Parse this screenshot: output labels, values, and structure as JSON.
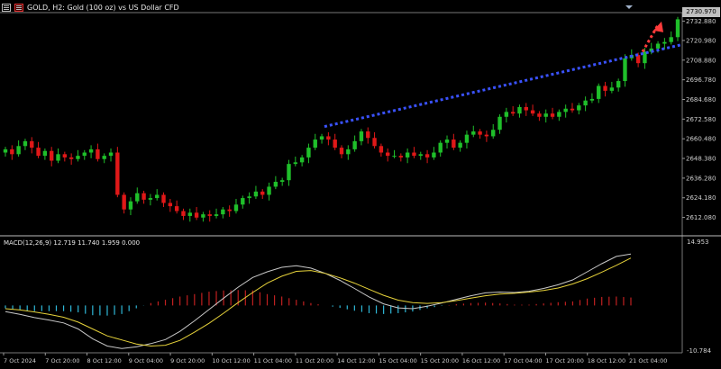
{
  "window": {
    "title": "GOLD, H2:  Gold (100 oz) vs US Dollar CFD",
    "current_price_label": "2730.970"
  },
  "macd": {
    "label": "MACD(12,26,9) 12.719 11.740 1.959 0.000",
    "top_label": "14.953",
    "bottom_label": "-10.784"
  },
  "colors": {
    "background": "#000000",
    "bull_candle": "#1fbf2a",
    "bear_candle": "#e01818",
    "trendline": "#3a52ff",
    "projection_arrow": "#ff3b3b",
    "hist_positive": "#c02020",
    "hist_negative": "#2fb8d8",
    "macd_line": "#c8c8c8",
    "signal_line": "#e6d23a",
    "axis": "#a0a0a0"
  },
  "chart_data": [
    {
      "type": "candlestick",
      "series_name": "GOLD H2",
      "y_ticks": [
        "2732.880",
        "2720.980",
        "2708.880",
        "2696.780",
        "2684.680",
        "2672.580",
        "2660.480",
        "2648.380",
        "2636.280",
        "2624.180",
        "2612.080"
      ],
      "x_ticks": [
        "7 Oct 2024",
        "7 Oct 20:00",
        "8 Oct 12:00",
        "9 Oct 04:00",
        "9 Oct 20:00",
        "10 Oct 12:00",
        "11 Oct 04:00",
        "11 Oct 20:00",
        "14 Oct 12:00",
        "15 Oct 04:00",
        "15 Oct 20:00",
        "16 Oct 12:00",
        "17 Oct 04:00",
        "17 Oct 20:00",
        "18 Oct 12:00",
        "21 Oct 04:00"
      ],
      "ylim": [
        2603.0,
        2737.0
      ],
      "closes": [
        2654,
        2651,
        2656,
        2659,
        2655,
        2650,
        2653,
        2647,
        2651,
        2649,
        2648,
        2650,
        2652,
        2654,
        2648,
        2650,
        2652,
        2626,
        2617,
        2622,
        2627,
        2623,
        2624,
        2626,
        2621,
        2619,
        2616,
        2613,
        2615,
        2612,
        2614,
        2613,
        2614,
        2617,
        2616,
        2620,
        2624,
        2625,
        2628,
        2626,
        2631,
        2634,
        2635,
        2645,
        2646,
        2649,
        2655,
        2660,
        2662,
        2660,
        2655,
        2651,
        2654,
        2659,
        2665,
        2661,
        2656,
        2652,
        2650,
        2650,
        2649,
        2652,
        2650,
        2651,
        2649,
        2652,
        2658,
        2660,
        2655,
        2658,
        2663,
        2665,
        2663,
        2662,
        2666,
        2674,
        2677,
        2676,
        2680,
        2678,
        2676,
        2674,
        2676,
        2674,
        2677,
        2679,
        2678,
        2681,
        2684,
        2685,
        2693,
        2690,
        2692,
        2696,
        2710,
        2712,
        2707,
        2714,
        2716,
        2719,
        2720,
        2723,
        2734
      ],
      "x_last": "21 Oct 04:00",
      "trendline": {
        "style": "dotted",
        "from": [
          "11 Oct 20:00",
          2668
        ],
        "to": [
          "21 Oct 04:00+",
          2716
        ]
      },
      "projection": {
        "style": "dotted-arrow",
        "direction": "up",
        "to_value": 2734
      }
    },
    {
      "type": "macd",
      "params": "12,26,9",
      "ylim": [
        -10.784,
        14.953
      ],
      "macd": [
        -1.5,
        -2.2,
        -3.0,
        -3.6,
        -4.3,
        -5.8,
        -8.2,
        -10.0,
        -10.6,
        -10.2,
        -9.4,
        -8.4,
        -6.4,
        -3.8,
        -1.0,
        1.8,
        4.5,
        6.9,
        8.3,
        9.4,
        9.8,
        9.2,
        7.9,
        6.2,
        4.2,
        2.1,
        0.4,
        -0.6,
        -0.8,
        -0.2,
        0.6,
        1.5,
        2.4,
        3.1,
        3.3,
        3.2,
        3.5,
        4.2,
        5.1,
        6.3,
        8.3,
        10.3,
        12.1,
        12.7
      ],
      "signal": [
        -0.8,
        -1.1,
        -1.6,
        -2.2,
        -2.9,
        -4.1,
        -5.8,
        -7.5,
        -8.5,
        -9.5,
        -10.0,
        -9.8,
        -8.6,
        -6.6,
        -4.4,
        -1.9,
        0.7,
        3.2,
        5.5,
        7.2,
        8.4,
        8.6,
        7.9,
        6.8,
        5.5,
        4.0,
        2.5,
        1.3,
        0.7,
        0.5,
        0.7,
        1.2,
        1.8,
        2.4,
        2.8,
        3.0,
        3.3,
        3.7,
        4.3,
        5.3,
        6.6,
        8.2,
        9.9,
        11.7
      ],
      "histogram": [
        -0.7,
        -1.1,
        -1.4,
        -1.4,
        -1.4,
        -1.7,
        -2.4,
        -2.5,
        -2.1,
        -0.7,
        0.6,
        1.4,
        2.2,
        2.8,
        3.4,
        3.7,
        3.8,
        3.7,
        2.8,
        2.2,
        1.4,
        0.6,
        0.0,
        -0.6,
        -1.3,
        -1.9,
        -2.1,
        -1.9,
        -1.5,
        -0.7,
        -0.1,
        0.3,
        0.6,
        0.7,
        0.5,
        0.2,
        0.2,
        0.5,
        0.8,
        1.0,
        1.7,
        2.1,
        2.2,
        1.96
      ]
    }
  ]
}
